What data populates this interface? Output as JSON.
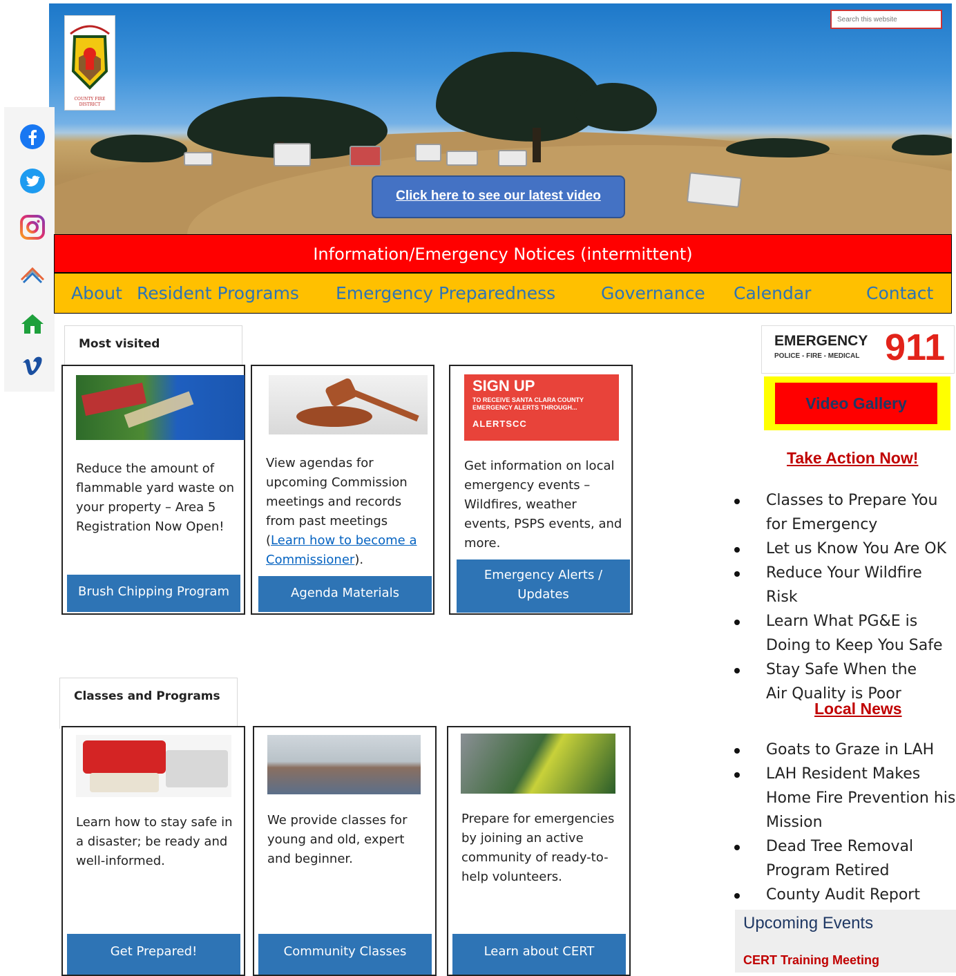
{
  "header": {
    "logo_text": "LOS ALTOS HILLS COUNTY FIRE DISTRICT",
    "search_placeholder": "Search this website",
    "video_link": "Click here to see our latest video"
  },
  "social": [
    "facebook-icon",
    "twitter-icon",
    "instagram-icon",
    "mountain-icon",
    "home-icon",
    "vimeo-icon"
  ],
  "notice_bar": "Information/Emergency Notices (intermittent)",
  "nav": [
    "About",
    "Resident Programs",
    "Emergency Preparedness",
    "Governance",
    "Calendar",
    "Contact"
  ],
  "most_visited": {
    "heading": "Most visited",
    "cards": [
      {
        "text": "Reduce the amount of flammable yard waste on your property – Area 5 Registration Now Open!",
        "button": "Brush Chipping Program"
      },
      {
        "text_before": "View agendas for upcoming Commission meetings and records from past meetings (",
        "link": "Learn how to become a Commissioner",
        "text_after": ").",
        "button": "Agenda Materials"
      },
      {
        "image_title": "SIGN UP",
        "image_subtitle": "TO RECEIVE SANTA CLARA COUNTY EMERGENCY ALERTS THROUGH...",
        "image_brand": "ALERTSCC",
        "text": "Get information on local emergency events – Wildfires, weather events, PSPS events, and more.",
        "button": "Emergency Alerts / Updates"
      }
    ]
  },
  "classes": {
    "heading": "Classes and Programs",
    "cards": [
      {
        "text": "Learn how to stay safe in a disaster; be ready and well-informed.",
        "button": "Get Prepared!"
      },
      {
        "text": "We provide classes for young and old, expert and beginner.",
        "button": "Community Classes"
      },
      {
        "text": "Prepare for emergencies by joining an active community of ready-to-help volunteers.",
        "button": "Learn about CERT"
      }
    ]
  },
  "sidebar": {
    "emergency_title": "EMERGENCY",
    "emergency_number": "911",
    "emergency_sub": "POLICE - FIRE - MEDICAL",
    "video_gallery": "Video Gallery",
    "take_action_heading": "Take Action Now!",
    "take_action_items": [
      "Classes to Prepare You for Emergency",
      "Let us Know You Are OK",
      "Reduce Your Wildfire Risk",
      "Learn What PG&E is Doing to Keep You Safe",
      "Stay Safe When the Air Quality is Poor"
    ],
    "local_news_heading": "Local News",
    "local_news_items": [
      "Goats to Graze in LAH",
      "LAH Resident Makes Home Fire Prevention his Mission",
      "Dead Tree Removal Program Retired",
      "County Audit Report"
    ],
    "events_heading": "Upcoming Events",
    "events_first": "CERT Training Meeting"
  },
  "colors": {
    "notice": "#ff0000",
    "nav": "#ffc000",
    "nav_text": "#2e74b5",
    "button": "#2e74b5",
    "side_heading": "#c00000"
  }
}
